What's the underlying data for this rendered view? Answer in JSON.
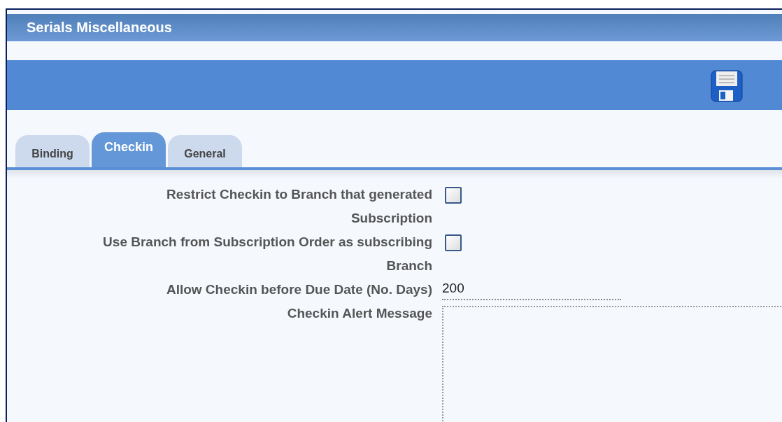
{
  "window": {
    "title": "Serials Miscellaneous"
  },
  "tabs": [
    {
      "label": "Binding",
      "selected": false
    },
    {
      "label": "Checkin",
      "selected": true
    },
    {
      "label": "General",
      "selected": false
    }
  ],
  "fields": [
    {
      "kind": "checkbox",
      "label": "Restrict Checkin to Branch that generated Subscription",
      "checked": false
    },
    {
      "kind": "checkbox",
      "label": "Use Branch from Subscription Order as subscribing Branch",
      "checked": false
    },
    {
      "kind": "text",
      "label": "Allow Checkin before Due Date (No. Days)",
      "value": "200"
    },
    {
      "kind": "textarea",
      "label": "Checkin Alert Message"
    }
  ]
}
